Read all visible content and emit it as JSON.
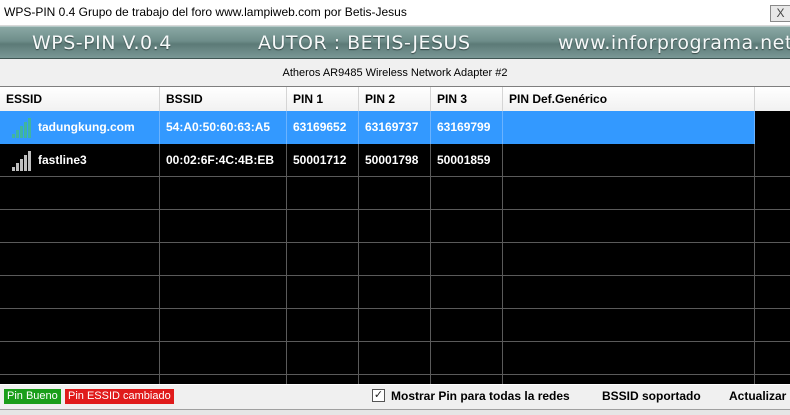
{
  "window": {
    "title": "WPS-PIN 0.4 Grupo de trabajo del foro www.lampiweb.com por Betis-Jesus",
    "close_glyph": "X"
  },
  "banner": {
    "app": "WPS-PIN V.0.4",
    "author": "AUTOR : BETIS-JESUS",
    "site": "www.inforprograma.net"
  },
  "adapter": "Atheros AR9485 Wireless Network Adapter #2",
  "table": {
    "columns": [
      "ESSID",
      "BSSID",
      "PIN 1",
      "PIN 2",
      "PIN 3",
      "PIN Def.Genérico"
    ],
    "rows": [
      {
        "essid": "tadungkung.com",
        "bssid": "54:A0:50:60:63:A5",
        "pin1": "63169652",
        "pin2": "63169737",
        "pin3": "63169799",
        "pin_def": "",
        "selected": true,
        "signal_level": 5
      },
      {
        "essid": "fastline3",
        "bssid": "00:02:6F:4C:4B:EB",
        "pin1": "50001712",
        "pin2": "50001798",
        "pin3": "50001859",
        "pin_def": "",
        "selected": false,
        "signal_level": 5
      }
    ],
    "signal_colors": {
      "strong": "#3fb5a0",
      "weak": "#bfbfbf"
    }
  },
  "status": {
    "pin_bueno": "Pin Bueno",
    "pin_essid_cambiado": "Pin ESSID cambiado",
    "mostrar_pin_label": "Mostrar Pin para todas la redes",
    "mostrar_pin_checked": true,
    "bssid_soportado": "BSSID soportado",
    "actualizar": "Actualizar"
  },
  "colors": {
    "banner": "#6e8d8a",
    "selection": "#3399ff",
    "grid_bg": "#000000",
    "tag_green": "#1a9e1a",
    "tag_red": "#e01b1b"
  }
}
